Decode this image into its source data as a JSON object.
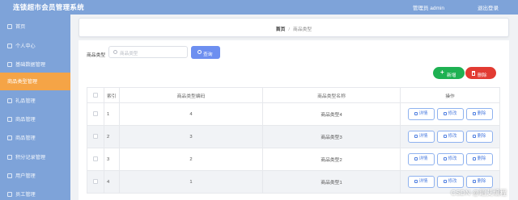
{
  "app": {
    "title": "连锁超市会员管理系统"
  },
  "header": {
    "admin_label": "管理员 admin",
    "logout_label": "退出登录"
  },
  "sidebar": {
    "items": [
      {
        "label": "首页"
      },
      {
        "label": "个人中心"
      },
      {
        "label": "基础数据管理"
      },
      {
        "label": "商品类型管理",
        "active": true
      },
      {
        "label": "礼品管理"
      },
      {
        "label": "商品管理"
      },
      {
        "label": "商品管理"
      },
      {
        "label": "积分记录管理"
      },
      {
        "label": "用户管理"
      },
      {
        "label": "员工管理"
      }
    ]
  },
  "breadcrumb": {
    "home": "首页",
    "separator": "/",
    "current": "商品类型"
  },
  "filter": {
    "label": "商品类型",
    "placeholder": "商品类型",
    "query_label": "查询"
  },
  "actions": {
    "add_label": "新增",
    "delete_label": "删除"
  },
  "table": {
    "headers": {
      "index": "索引",
      "code": "商品类型编码",
      "name": "商品类型名称",
      "ops": "操作"
    },
    "rows": [
      {
        "index": "1",
        "code": "4",
        "name": "商品类型4"
      },
      {
        "index": "2",
        "code": "3",
        "name": "商品类型3"
      },
      {
        "index": "3",
        "code": "2",
        "name": "商品类型2"
      },
      {
        "index": "4",
        "code": "1",
        "name": "商品类型1"
      }
    ],
    "ops": {
      "detail": "详情",
      "edit": "修改",
      "delete": "删除"
    }
  },
  "watermark": "CSDN @蹈艾编程",
  "colors": {
    "sidebar": "#7ea3d9",
    "active": "#f5a446",
    "primary": "#6d8ff0",
    "success": "#1eb152",
    "danger": "#e23b32"
  }
}
